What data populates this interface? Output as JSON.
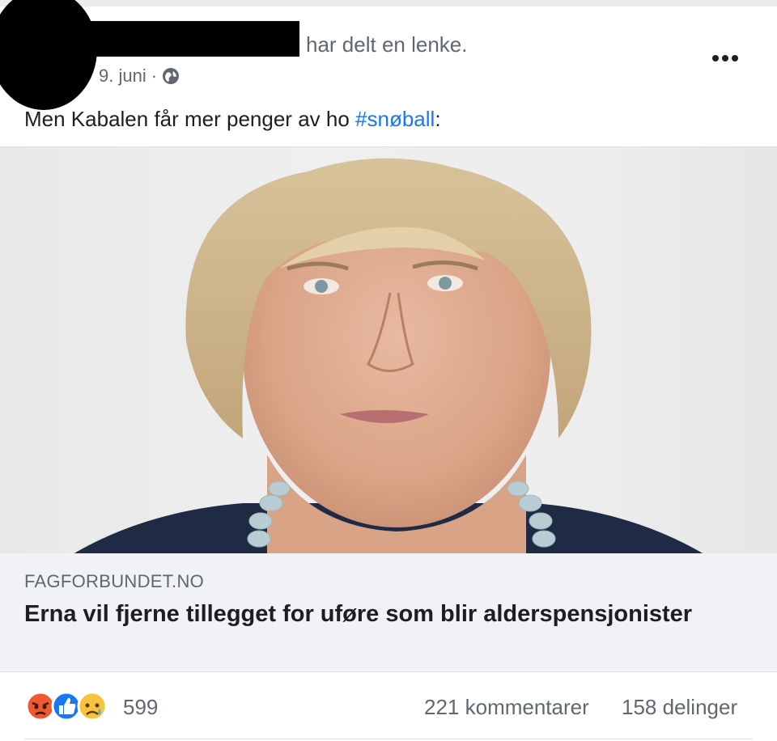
{
  "post": {
    "shared_text": "har delt en lenke.",
    "date": "9. juni",
    "separator": "·",
    "message_prefix": "Men Kabalen får mer penger av ho ",
    "hashtag": "#snøball",
    "message_suffix": ":"
  },
  "link": {
    "domain": "FAGFORBUNDET.NO",
    "headline": "Erna vil fjerne tillegget for uføre som blir alderspensjonister",
    "info_symbol": "i"
  },
  "reactions": {
    "icons": [
      "angry-icon",
      "like-icon",
      "sad-icon"
    ],
    "count": "599",
    "comments": "221 kommentarer",
    "shares": "158 delinger"
  },
  "colors": {
    "link_blue": "#1877f2",
    "meta_gray": "#606770",
    "like_blue": "#1877f2",
    "angry_orange": "#f0582f",
    "sad_yellow": "#f7c23c"
  }
}
